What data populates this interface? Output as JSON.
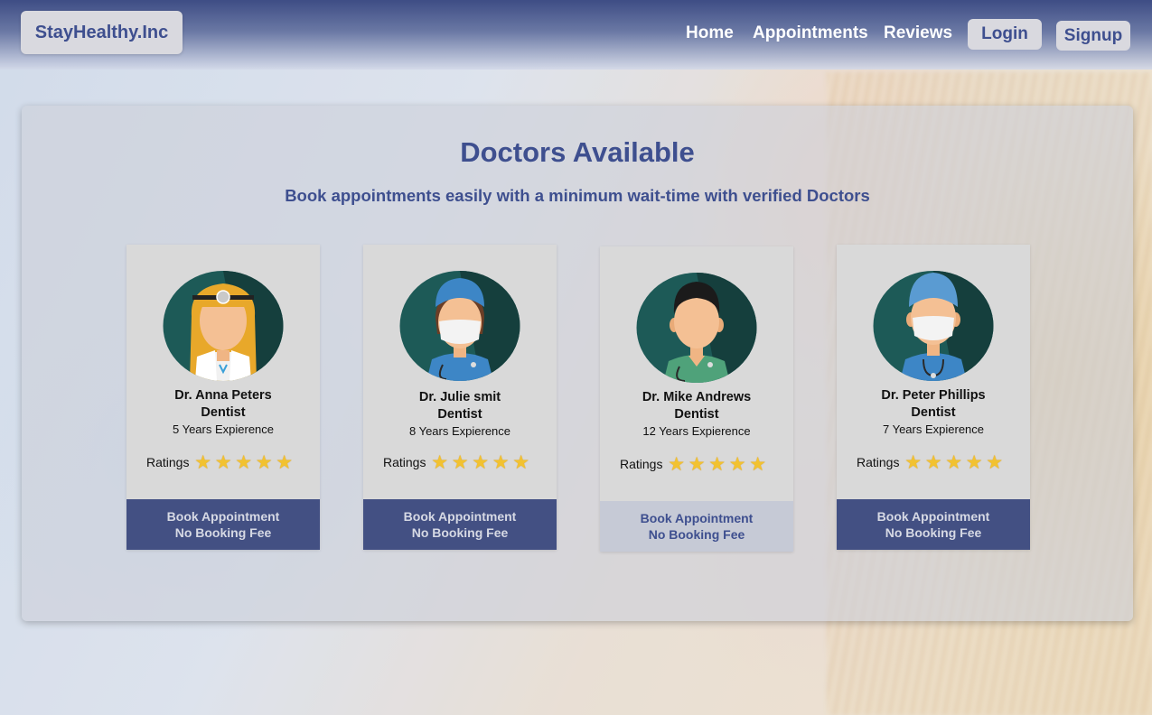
{
  "brand": "StayHealthy.Inc",
  "nav": {
    "links": [
      "Home",
      "Appointments",
      "Reviews"
    ],
    "login": "Login",
    "signup": "Signup"
  },
  "main": {
    "title": "Doctors Available",
    "subtitle": "Book appointments easily with a minimum wait-time with verified Doctors"
  },
  "doctors": [
    {
      "name": "Dr. Anna Peters",
      "specialty": "Dentist",
      "experience": "5 Years Expierence",
      "ratings_label": "Ratings",
      "rating": 5,
      "book_line1": "Book Appointment",
      "book_line2": "No Booking Fee",
      "avatar": "female-doctor-head-mirror-avatar"
    },
    {
      "name": "Dr. Julie smit",
      "specialty": "Dentist",
      "experience": "8 Years Expierence",
      "ratings_label": "Ratings",
      "rating": 5,
      "book_line1": "Book Appointment",
      "book_line2": "No Booking Fee",
      "avatar": "female-surgeon-mask-avatar"
    },
    {
      "name": "Dr. Mike Andrews",
      "specialty": "Dentist",
      "experience": "12 Years Expierence",
      "ratings_label": "Ratings",
      "rating": 5,
      "book_line1": "Book Appointment",
      "book_line2": "No Booking Fee",
      "avatar": "male-doctor-scrubs-avatar"
    },
    {
      "name": "Dr. Peter Phillips",
      "specialty": "Dentist",
      "experience": "7 Years Expierence",
      "ratings_label": "Ratings",
      "rating": 5,
      "book_line1": "Book Appointment",
      "book_line2": "No Booking Fee",
      "avatar": "male-surgeon-mask-avatar"
    }
  ],
  "colors": {
    "brand_blue": "#3e4f8f",
    "button_blue": "#435083",
    "button_hover": "#c6cad6",
    "card_bg": "#d9d9d9",
    "star": "#f2c230",
    "avatar_bg": "#1d5a57"
  }
}
